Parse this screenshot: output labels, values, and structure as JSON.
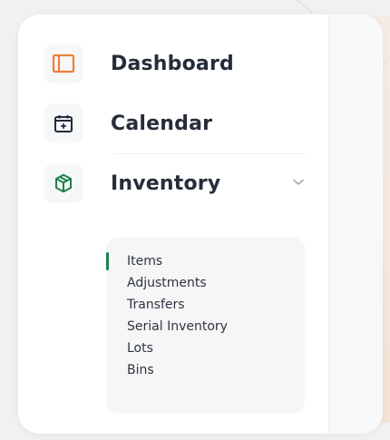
{
  "theme": {
    "dashboard_icon_color": "#ef7d3b",
    "calendar_icon_color": "#1f2d3d",
    "inventory_icon_color": "#1f7f4f",
    "active_indicator_color": "#1f7f4f"
  },
  "sidebar": {
    "items": [
      {
        "label": "Dashboard",
        "icon": "dashboard-icon"
      },
      {
        "label": "Calendar",
        "icon": "calendar-icon"
      },
      {
        "label": "Inventory",
        "icon": "inventory-icon",
        "expanded": true
      }
    ],
    "inventory_submenu": [
      {
        "label": "Items",
        "active": true
      },
      {
        "label": "Adjustments",
        "active": false
      },
      {
        "label": "Transfers",
        "active": false
      },
      {
        "label": "Serial Inventory",
        "active": false
      },
      {
        "label": "Lots",
        "active": false
      },
      {
        "label": "Bins",
        "active": false
      }
    ]
  }
}
